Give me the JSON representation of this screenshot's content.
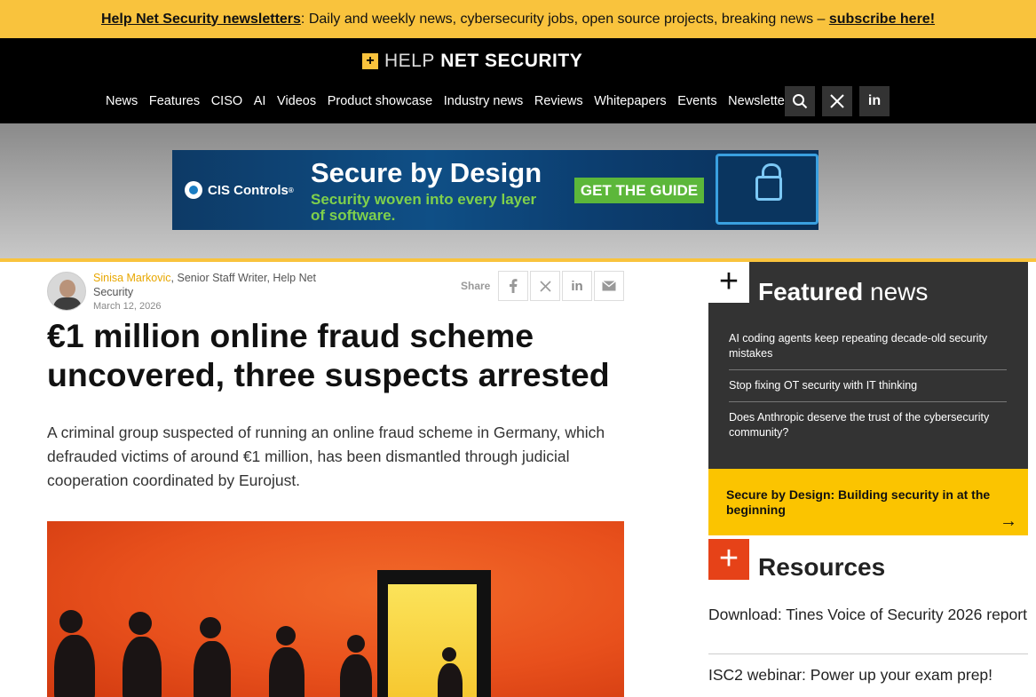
{
  "topbar": {
    "newsletter_link": "Help Net Security newsletters",
    "text": ": Daily and weekly news, cybersecurity jobs, open source projects, breaking news – ",
    "subscribe_link": "subscribe here!"
  },
  "header": {
    "logo_plus": "+",
    "logo_help": "HELP",
    "logo_net": " NET ",
    "logo_security": "SECURITY",
    "nav": [
      "News",
      "Features",
      "CISO",
      "AI",
      "Videos",
      "Product showcase",
      "Industry news",
      "Reviews",
      "Whitepapers",
      "Events",
      "Newsletters"
    ],
    "icons": [
      "search-icon",
      "x-icon",
      "linkedin-icon"
    ],
    "linkedin_label": "in"
  },
  "ad": {
    "brand": "CIS Controls",
    "brand_mark": "®",
    "title": "Secure by Design",
    "subtitle": "Security woven into every layer of software.",
    "cta": "GET THE GUIDE",
    "colors": {
      "cta": "#5cb73a",
      "subtitle": "#7fd04b"
    }
  },
  "article": {
    "author": "Sinisa Markovic",
    "author_role": ", Senior Staff Writer, Help Net Security",
    "date": "March 12, 2026",
    "share_label": "Share",
    "share_icons": [
      "facebook-icon",
      "x-icon",
      "linkedin-icon",
      "mail-icon"
    ],
    "headline": "€1 million online fraud scheme uncovered, three suspects arrested",
    "lede": "A criminal group suspected of running an online fraud scheme in Germany, which defrauded victims of around €1 million, has been dismantled through judicial cooperation coordinated by Eurojust."
  },
  "sidebar": {
    "featured_plus": "+",
    "featured_bold": "Featured",
    "featured_rest": " news",
    "featured_items": [
      "AI coding agents keep repeating decade-old security mistakes",
      "Stop fixing OT security with IT thinking",
      "Does Anthropic deserve the trust of the cybersecurity community?"
    ],
    "promo": "Secure by Design: Building security in at the beginning",
    "promo_arrow": "→",
    "resources_plus": "+",
    "resources_title": "Resources",
    "resources": [
      "Download: Tines Voice of Security 2026 report",
      "ISC2 webinar: Power up your exam prep!"
    ]
  },
  "colors": {
    "accent_yellow": "#f9c33d",
    "resources_red": "#e64218",
    "featured_bg": "#333333",
    "promo_bg": "#fbc400"
  }
}
